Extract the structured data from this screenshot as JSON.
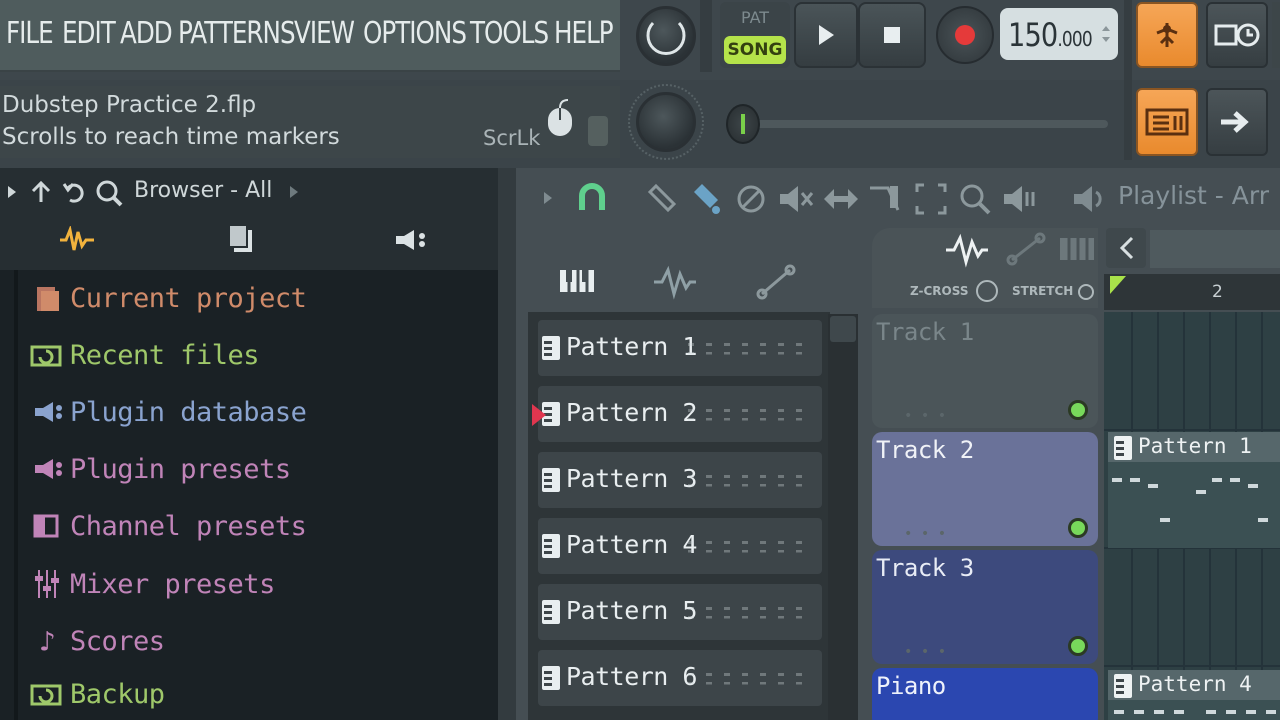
{
  "menu": {
    "items": [
      "FILE",
      "EDIT",
      "ADD",
      "PATTERNS",
      "VIEW",
      "OPTIONS",
      "TOOLS",
      "HELP"
    ]
  },
  "transport": {
    "pat_label": "PAT",
    "song_label": "SONG",
    "tempo_main": "150",
    "tempo_decimal": ".000"
  },
  "hint": {
    "title": "Dubstep Practice 2.flp",
    "text": "Scrolls to reach time markers",
    "scrlk": "ScrLk"
  },
  "browser": {
    "title": "Browser - All",
    "items": [
      {
        "label": "Current project",
        "icon": "folder-icon",
        "color": "#d08b6a"
      },
      {
        "label": "Recent files",
        "icon": "recent-icon",
        "color": "#9fc86a"
      },
      {
        "label": "Plugin database",
        "icon": "plugin-icon",
        "color": "#8aa3cf"
      },
      {
        "label": "Plugin presets",
        "icon": "plugin-preset-icon",
        "color": "#c084b8"
      },
      {
        "label": "Channel presets",
        "icon": "channel-icon",
        "color": "#c084b8"
      },
      {
        "label": "Mixer presets",
        "icon": "mixer-icon",
        "color": "#c084b8"
      },
      {
        "label": "Scores",
        "icon": "note-icon",
        "color": "#c084b8"
      },
      {
        "label": "Backup",
        "icon": "backup-icon",
        "color": "#9fc86a"
      }
    ]
  },
  "playlist": {
    "title": "Playlist - Arr",
    "zcross": "Z-CROSS",
    "stretch": "STRETCH",
    "ruler_bar": "2",
    "patterns": [
      "Pattern 1",
      "Pattern 2",
      "Pattern 3",
      "Pattern 4",
      "Pattern 5",
      "Pattern 6"
    ],
    "tracks": [
      {
        "label": "Track 1",
        "color": "#4b5559",
        "text_color": "#7a868a"
      },
      {
        "label": "Track 2",
        "color": "#6a7299",
        "text_color": "#f0f2f7"
      },
      {
        "label": "Track 3",
        "color": "#3d4a7d",
        "text_color": "#e8ecf5"
      },
      {
        "label": "Piano",
        "color": "#2b47b0",
        "text_color": "#eef2fb"
      }
    ],
    "clips": [
      {
        "label": "Pattern 1"
      },
      {
        "label": "Pattern 4"
      }
    ]
  }
}
